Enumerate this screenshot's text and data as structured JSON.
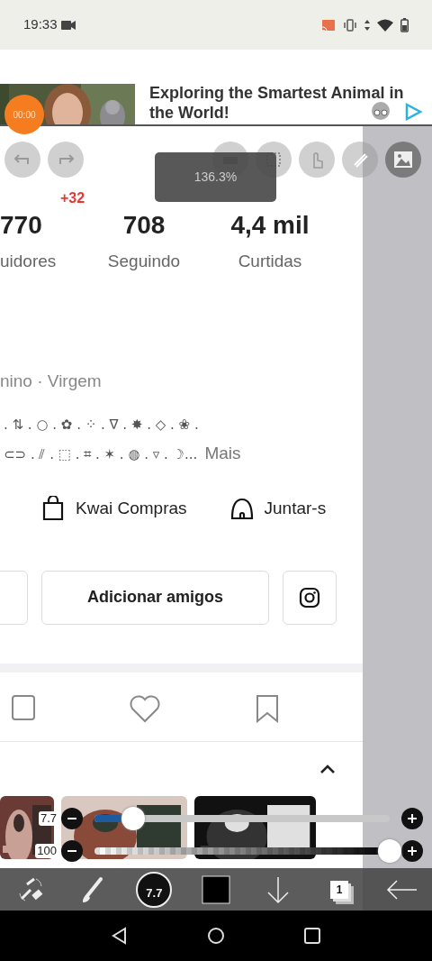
{
  "status_bar": {
    "time": "19:33"
  },
  "ad": {
    "headline": "Exploring the Smartest Animal in the World!"
  },
  "recording_timer": "00:00",
  "profile": {
    "stats": [
      {
        "value": "770",
        "label": "uidores",
        "badge": "+32"
      },
      {
        "value": "708",
        "label": "Seguindo"
      },
      {
        "value": "4,4 mil",
        "label": "Curtidas"
      }
    ],
    "info": "nino · Virgem",
    "bio_lines": [
      ". ⇅ . ○ . ✿ . ⁘ . ∇ . ✸ . ◇ . ❀ .",
      "⊂⊃ . ⫽ . ⬚ . ⌗ . ✶ . ◍ . ▿ . ☽..."
    ],
    "more": "Mais",
    "shortcuts": [
      {
        "kind": "bag",
        "label": "Kwai Compras"
      },
      {
        "kind": "dome",
        "label": "Juntar-s"
      }
    ],
    "add_friends": "Adicionar amigos"
  },
  "editor": {
    "zoom": "136.3%",
    "sliders": [
      {
        "kind": "size",
        "reading": "7.7",
        "level": 0.13
      },
      {
        "kind": "opacity",
        "reading": "100",
        "level": 1
      }
    ],
    "brush_size": "7.7",
    "layers": "1"
  }
}
